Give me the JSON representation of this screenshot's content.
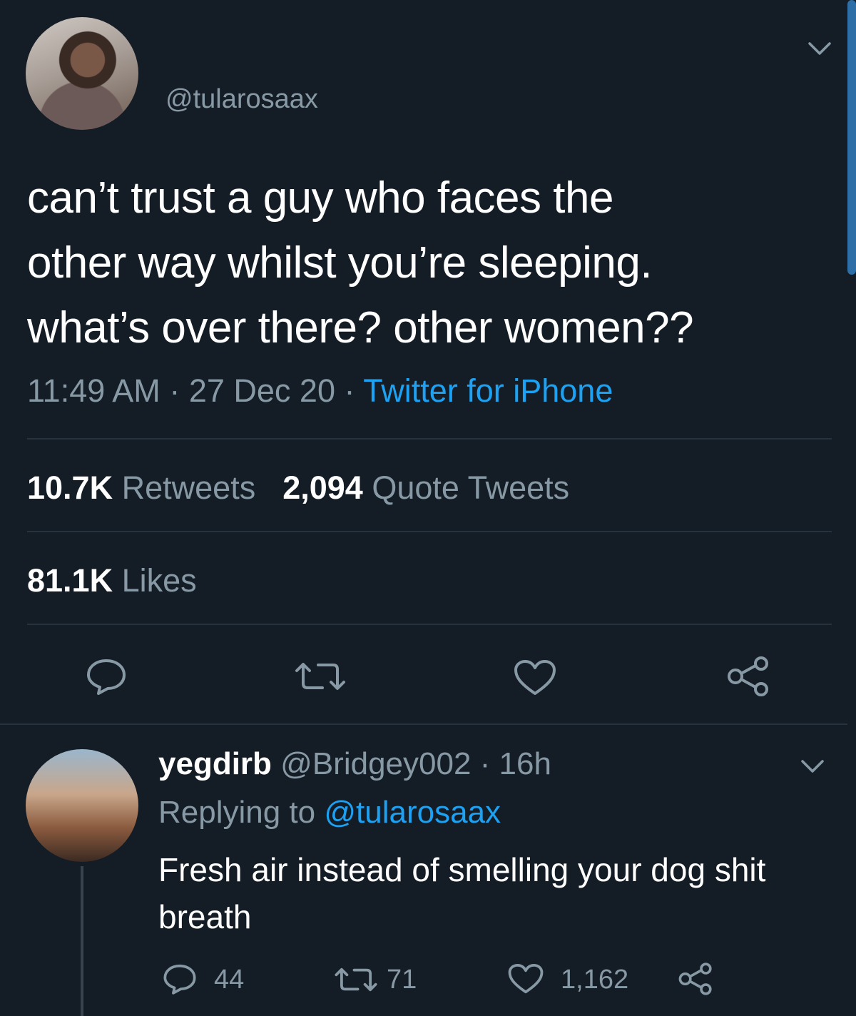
{
  "tweet": {
    "handle": "@tularosaax",
    "text_lines": [
      "can’t trust a guy who faces the",
      "other way whilst you’re sleeping.",
      "what’s over there? other women??"
    ],
    "time": "11:49 AM",
    "date": "27 Dec 20",
    "separator": "·",
    "source": "Twitter for iPhone",
    "retweets_count": "10.7K",
    "retweets_label": "Retweets",
    "quote_count": "2,094",
    "quote_label": "Quote Tweets",
    "likes_count": "81.1K",
    "likes_label": "Likes",
    "actions": [
      "reply-icon",
      "retweet-icon",
      "heart-icon",
      "share-icon"
    ]
  },
  "reply": {
    "display_name": "yegdirb",
    "handle": "@Bridgey002",
    "separator": "·",
    "time": "16h",
    "replying_to_label": "Replying to",
    "replying_to_handle": "@tularosaax",
    "text_lines": [
      "Fresh air instead of smelling your dog shit",
      "breath"
    ],
    "reply_count": "44",
    "retweet_count": "71",
    "like_count": "1,162"
  },
  "colors": {
    "background": "#141d26",
    "text": "#ffffff",
    "secondary": "#8899a6",
    "accent": "#1da1f2",
    "divider": "#26323d"
  }
}
